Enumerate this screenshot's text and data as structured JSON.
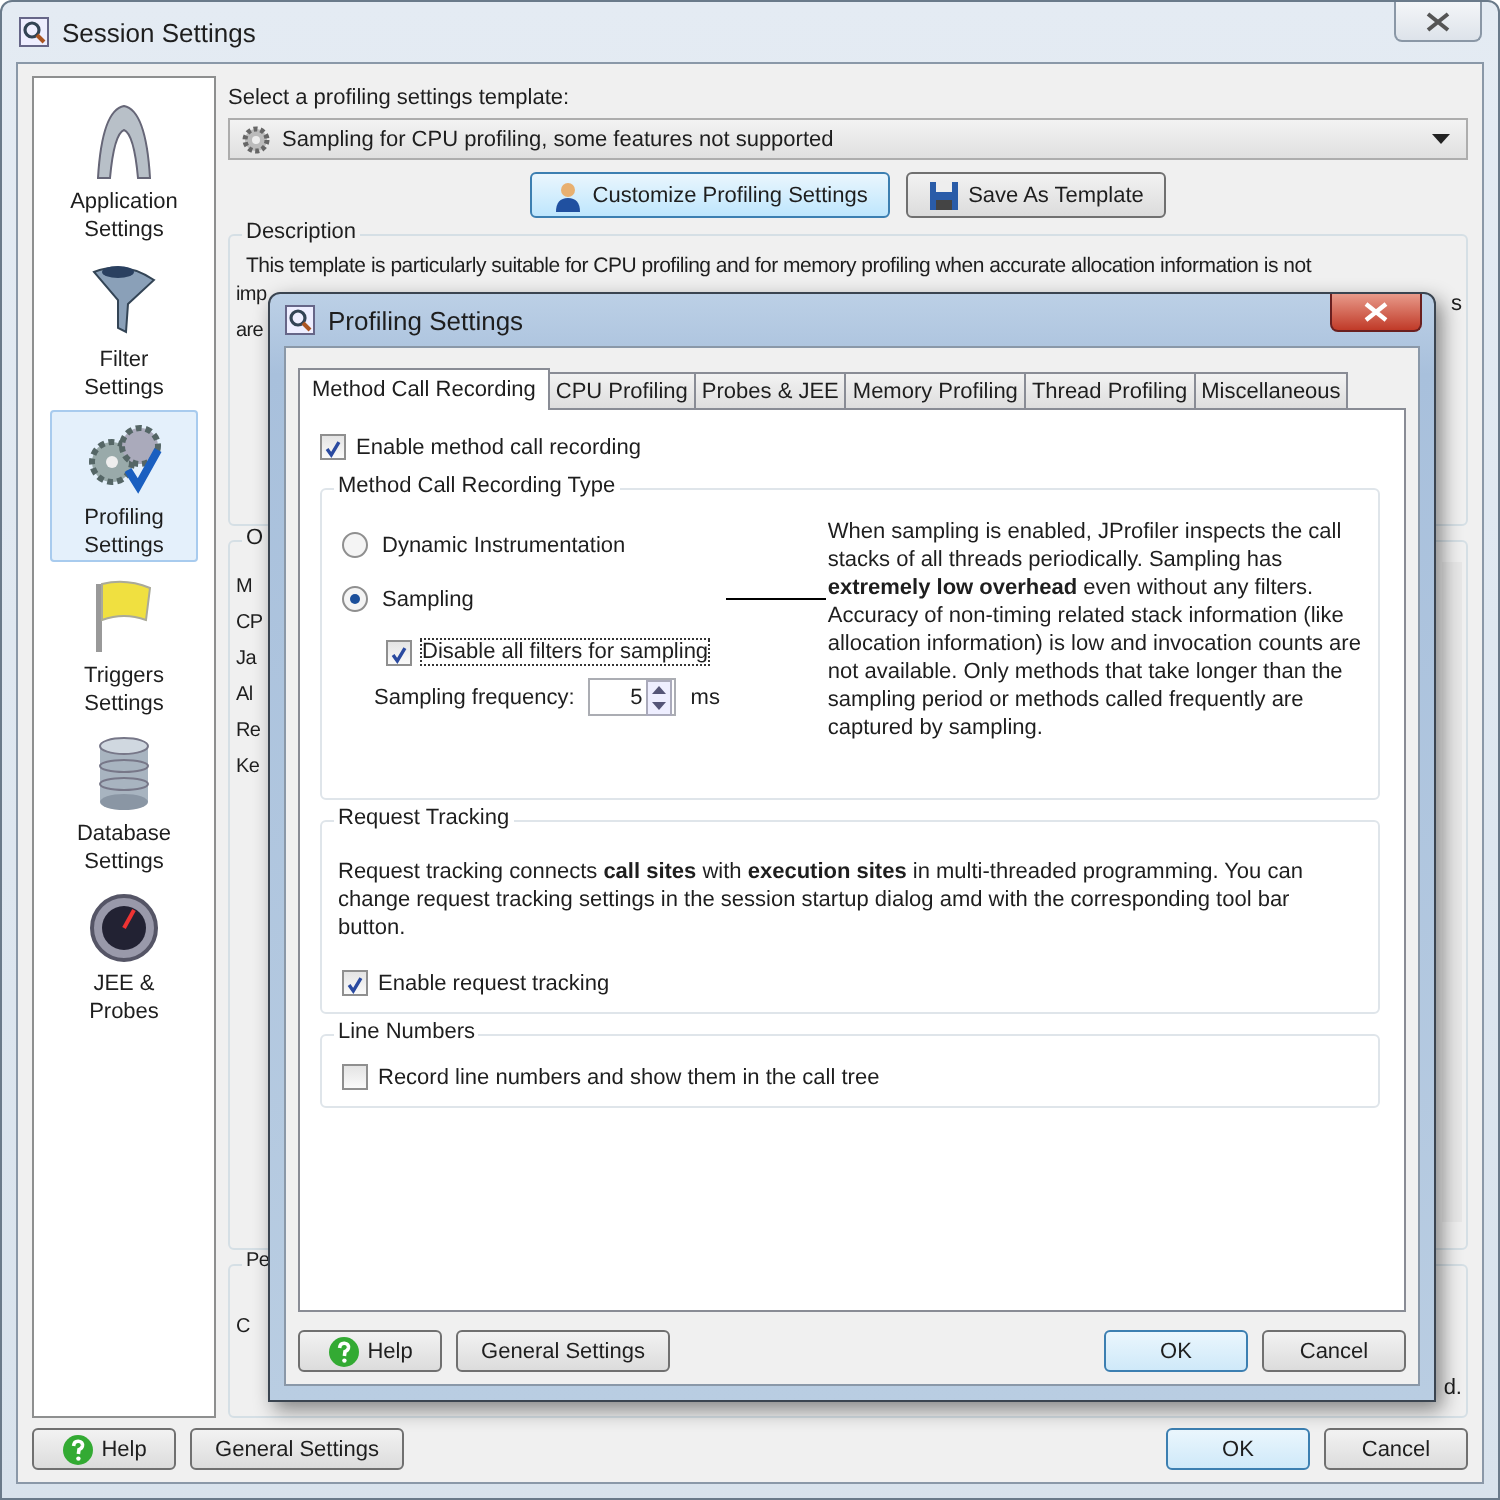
{
  "window": {
    "title": "Session Settings"
  },
  "sidebar": {
    "items": [
      {
        "label": "Application Settings",
        "selected": false
      },
      {
        "label": "Filter Settings",
        "selected": false
      },
      {
        "label": "Profiling Settings",
        "selected": true
      },
      {
        "label": "Triggers Settings",
        "selected": false
      },
      {
        "label": "Database Settings",
        "selected": false
      },
      {
        "label": "JEE & Probes",
        "selected": false
      }
    ]
  },
  "template": {
    "label": "Select a profiling settings template:",
    "value": "Sampling for CPU profiling, some features not supported"
  },
  "template_buttons": [
    {
      "label": "Customize Profiling Settings",
      "highlighted": true
    },
    {
      "label": "Save As Template",
      "highlighted": false
    }
  ],
  "description": {
    "title": "Description",
    "lines": [
      "This template is particularly suitable for CPU profiling and for memory profiling when accurate allocation information is not",
      "imp",
      "are"
    ],
    "right_fragment": "s"
  },
  "group_2": {
    "title": "O",
    "lines": [
      "M",
      "CP",
      "Ja",
      "Al",
      "Re",
      "Ke"
    ]
  },
  "group_3": {
    "title": "Pe",
    "lines": [
      "C"
    ],
    "right_fragment": "d."
  },
  "buttons": [
    {
      "label": "Help",
      "default": false
    },
    {
      "label": "General Settings",
      "default": false
    },
    {
      "label": "OK",
      "default": true
    },
    {
      "label": "Cancel",
      "default": false
    }
  ],
  "dialog": {
    "title": "Profiling Settings",
    "tabs": [
      {
        "label": "Method Call Recording",
        "selected": true
      },
      {
        "label": "CPU Profiling",
        "selected": false
      },
      {
        "label": "Probes & JEE",
        "selected": false
      },
      {
        "label": "Memory Profiling",
        "selected": false
      },
      {
        "label": "Thread Profiling",
        "selected": false
      },
      {
        "label": "Miscellaneous",
        "selected": false
      }
    ],
    "enable_recording": {
      "label": "Enable method call recording",
      "checked": true
    },
    "recording_type": {
      "title": "Method Call Recording Type",
      "options": [
        {
          "label": "Dynamic Instrumentation",
          "selected": false
        },
        {
          "label": "Sampling",
          "selected": true
        }
      ],
      "disable_filters": {
        "label": "Disable all filters for sampling",
        "checked": true,
        "focused": true
      },
      "frequency": {
        "label": "Sampling frequency:",
        "value": "5",
        "unit": "ms"
      },
      "explanation": "When sampling is enabled, JProfiler inspects the call stacks of all threads periodically. Sampling has **extremely low overhead** even without any filters. Accuracy of non-timing related stack information (like allocation information) is low and invocation counts are not available. Only methods that take longer than the sampling period or methods called frequently are captured by sampling."
    },
    "request_tracking": {
      "title": "Request Tracking",
      "text": "Request tracking connects **call sites** with **execution sites** in multi-threaded programming. You can change request tracking settings in the session startup dialog amd with the corresponding tool bar button.",
      "checkbox": {
        "label": "Enable request tracking",
        "checked": true
      }
    },
    "line_numbers": {
      "title": "Line Numbers",
      "checkbox": {
        "label": "Record line numbers and show them in the call tree",
        "checked": false
      }
    },
    "buttons": [
      {
        "label": "Help",
        "default": false
      },
      {
        "label": "General Settings",
        "default": false
      },
      {
        "label": "OK",
        "default": true
      },
      {
        "label": "Cancel",
        "default": false
      }
    ]
  }
}
